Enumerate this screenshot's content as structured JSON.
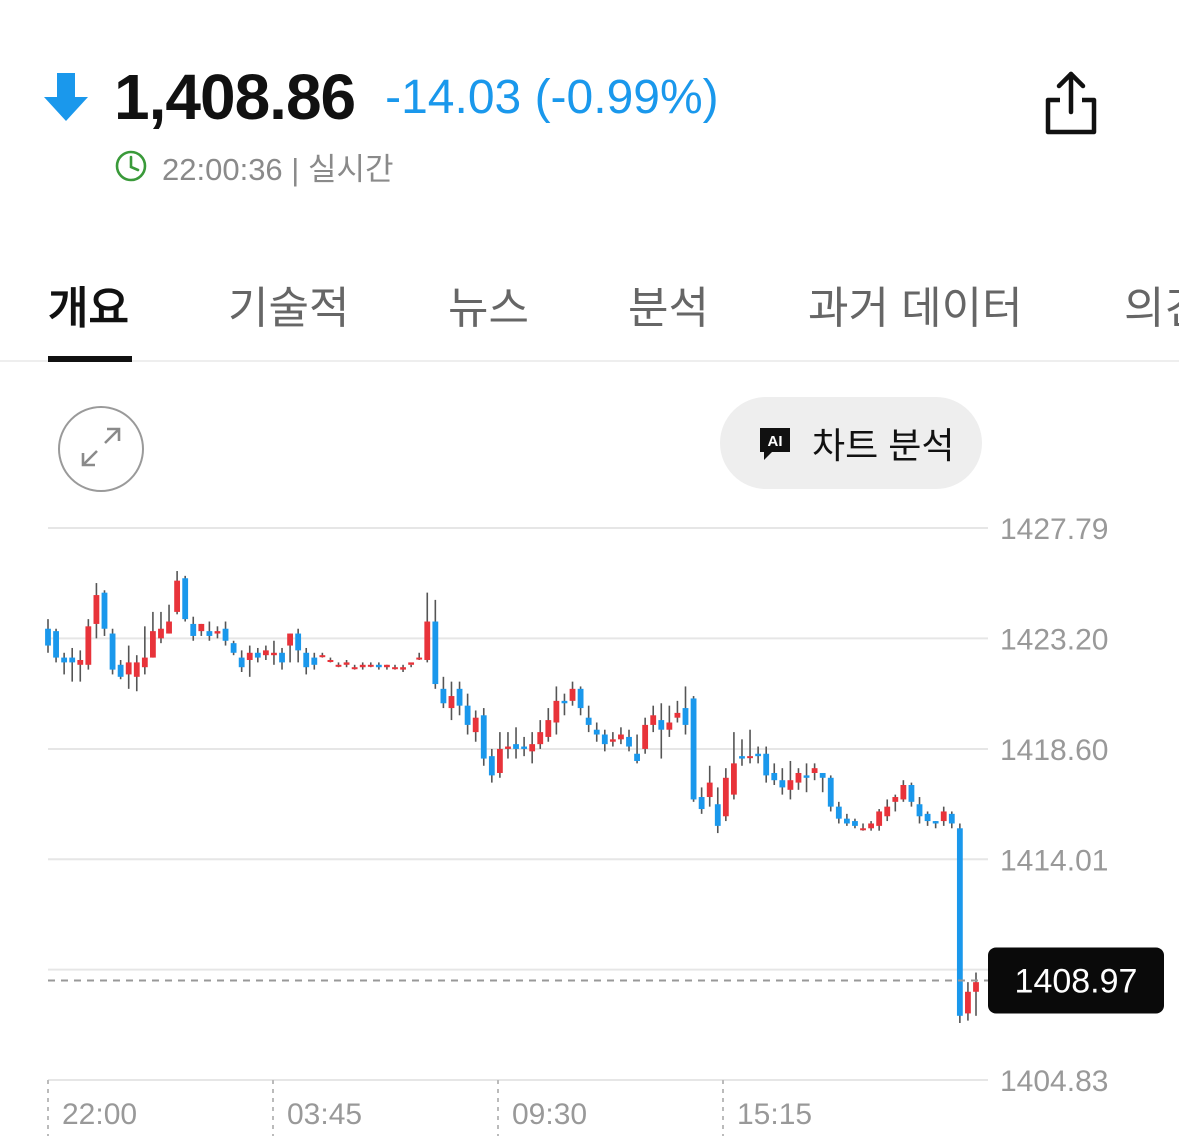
{
  "quote": {
    "direction": "down",
    "price": "1,408.86",
    "change": "-14.03 (-0.99%)",
    "time": "22:00:36 | 실시간",
    "colors": {
      "down": "#1a98ec",
      "up": "#e8333a",
      "clock": "#3a9a3a"
    }
  },
  "tabs": [
    {
      "label": "개요",
      "active": true
    },
    {
      "label": "기술적",
      "active": false
    },
    {
      "label": "뉴스",
      "active": false
    },
    {
      "label": "분석",
      "active": false
    },
    {
      "label": "과거 데이터",
      "active": false
    },
    {
      "label": "의견",
      "active": false
    }
  ],
  "toolbar": {
    "expand_icon": "expand-arrows-icon",
    "ai_badge": "AI",
    "ai_label": "차트 분석"
  },
  "chart_data": {
    "type": "candlestick",
    "y_ticks": [
      "1427.79",
      "1423.20",
      "1418.60",
      "1414.01",
      "1404.83"
    ],
    "ylim": [
      1404.83,
      1427.79
    ],
    "x_ticks": [
      "22:00",
      "03:45",
      "09:30",
      "15:15"
    ],
    "grid": true,
    "current_price_label": "1408.97",
    "current_price": 1408.97,
    "candles": [
      [
        1423.6,
        1422.9,
        1424.0,
        1422.6
      ],
      [
        1423.5,
        1422.4,
        1423.6,
        1422.2
      ],
      [
        1422.4,
        1422.2,
        1422.6,
        1421.7
      ],
      [
        1422.4,
        1422.2,
        1422.8,
        1421.4
      ],
      [
        1422.1,
        1422.3,
        1422.7,
        1421.4
      ],
      [
        1422.1,
        1423.7,
        1424.0,
        1421.9
      ],
      [
        1423.8,
        1425.0,
        1425.5,
        1423.2
      ],
      [
        1425.1,
        1423.6,
        1425.2,
        1423.3
      ],
      [
        1423.4,
        1421.9,
        1423.6,
        1421.7
      ],
      [
        1422.1,
        1421.6,
        1422.3,
        1421.5
      ],
      [
        1421.7,
        1422.2,
        1422.9,
        1421.1
      ],
      [
        1421.6,
        1422.2,
        1422.5,
        1421.0
      ],
      [
        1422.0,
        1422.4,
        1423.7,
        1421.7
      ],
      [
        1422.4,
        1423.5,
        1424.3,
        1422.4
      ],
      [
        1423.2,
        1423.6,
        1424.3,
        1423.0
      ],
      [
        1423.4,
        1423.9,
        1424.6,
        1423.4
      ],
      [
        1424.3,
        1425.6,
        1426.0,
        1424.2
      ],
      [
        1425.7,
        1424.0,
        1425.8,
        1423.9
      ],
      [
        1423.8,
        1423.3,
        1424.1,
        1423.1
      ],
      [
        1423.5,
        1423.8,
        1423.8,
        1423.3
      ],
      [
        1423.5,
        1423.3,
        1423.9,
        1423.1
      ],
      [
        1423.4,
        1423.5,
        1423.7,
        1423.2
      ],
      [
        1423.6,
        1423.1,
        1423.9,
        1422.9
      ],
      [
        1423.0,
        1422.6,
        1423.1,
        1422.5
      ],
      [
        1422.4,
        1422.0,
        1422.7,
        1421.8
      ],
      [
        1422.3,
        1422.6,
        1422.9,
        1421.6
      ],
      [
        1422.6,
        1422.4,
        1422.8,
        1422.2
      ],
      [
        1422.5,
        1422.7,
        1422.9,
        1422.3
      ],
      [
        1422.5,
        1422.6,
        1423.1,
        1422.1
      ],
      [
        1422.6,
        1422.2,
        1422.8,
        1421.9
      ],
      [
        1422.9,
        1423.4,
        1423.4,
        1422.2
      ],
      [
        1423.4,
        1422.7,
        1423.6,
        1422.2
      ],
      [
        1422.6,
        1422.0,
        1422.8,
        1421.7
      ],
      [
        1422.4,
        1422.1,
        1422.6,
        1421.9
      ],
      [
        1422.5,
        1422.5,
        1422.6,
        1422.4
      ],
      [
        1422.3,
        1422.3,
        1422.4,
        1422.2
      ],
      [
        1422.1,
        1422.1,
        1422.2,
        1422.0
      ],
      [
        1422.1,
        1422.2,
        1422.3,
        1422.0
      ],
      [
        1422.0,
        1422.0,
        1422.1,
        1421.9
      ],
      [
        1422.0,
        1422.1,
        1422.2,
        1421.9
      ],
      [
        1422.1,
        1422.1,
        1422.2,
        1422.0
      ],
      [
        1422.1,
        1422.0,
        1422.2,
        1421.9
      ],
      [
        1422.0,
        1422.1,
        1422.1,
        1421.9
      ],
      [
        1422.0,
        1422.0,
        1422.1,
        1421.9
      ],
      [
        1421.9,
        1422.0,
        1422.1,
        1421.8
      ],
      [
        1422.1,
        1422.2,
        1422.1,
        1422.0
      ],
      [
        1422.4,
        1422.4,
        1422.6,
        1422.3
      ],
      [
        1422.3,
        1423.9,
        1425.1,
        1422.2
      ],
      [
        1423.9,
        1421.3,
        1424.8,
        1421.1
      ],
      [
        1421.1,
        1420.5,
        1421.6,
        1420.3
      ],
      [
        1420.3,
        1420.8,
        1421.4,
        1419.8
      ],
      [
        1421.1,
        1420.4,
        1421.4,
        1420.0
      ],
      [
        1420.4,
        1419.6,
        1420.9,
        1419.2
      ],
      [
        1419.3,
        1419.9,
        1420.2,
        1418.9
      ],
      [
        1420.0,
        1418.2,
        1420.3,
        1417.9
      ],
      [
        1418.3,
        1417.5,
        1418.6,
        1417.2
      ],
      [
        1417.6,
        1418.6,
        1419.3,
        1417.4
      ],
      [
        1418.6,
        1418.7,
        1419.3,
        1418.2
      ],
      [
        1418.8,
        1418.6,
        1419.5,
        1418.2
      ],
      [
        1418.7,
        1418.6,
        1419.1,
        1418.3
      ],
      [
        1418.5,
        1418.8,
        1419.3,
        1418.0
      ],
      [
        1418.8,
        1419.3,
        1419.8,
        1418.6
      ],
      [
        1419.1,
        1419.8,
        1420.3,
        1418.9
      ],
      [
        1419.7,
        1420.6,
        1421.2,
        1419.2
      ],
      [
        1420.6,
        1420.5,
        1420.9,
        1420.0
      ],
      [
        1420.6,
        1421.1,
        1421.4,
        1420.4
      ],
      [
        1421.1,
        1420.3,
        1421.2,
        1420.0
      ],
      [
        1419.9,
        1419.6,
        1420.4,
        1419.3
      ],
      [
        1419.4,
        1419.2,
        1419.7,
        1418.9
      ],
      [
        1419.2,
        1418.8,
        1419.4,
        1418.5
      ],
      [
        1418.9,
        1419.0,
        1419.3,
        1418.7
      ],
      [
        1419.0,
        1419.2,
        1419.5,
        1418.8
      ],
      [
        1419.1,
        1418.7,
        1419.4,
        1418.5
      ],
      [
        1418.4,
        1418.1,
        1419.2,
        1418.0
      ],
      [
        1418.6,
        1419.6,
        1419.9,
        1418.4
      ],
      [
        1419.6,
        1420.0,
        1420.4,
        1419.3
      ],
      [
        1419.8,
        1419.4,
        1420.5,
        1418.2
      ],
      [
        1419.4,
        1419.7,
        1420.4,
        1419.1
      ],
      [
        1419.9,
        1420.1,
        1420.6,
        1419.7
      ],
      [
        1420.3,
        1419.6,
        1421.2,
        1419.2
      ],
      [
        1420.7,
        1416.5,
        1420.8,
        1416.4
      ],
      [
        1416.6,
        1416.1,
        1417.0,
        1415.9
      ],
      [
        1416.6,
        1417.2,
        1417.9,
        1416.2
      ],
      [
        1416.3,
        1415.4,
        1417.0,
        1415.1
      ],
      [
        1415.8,
        1417.4,
        1417.8,
        1415.6
      ],
      [
        1416.7,
        1418.0,
        1419.3,
        1416.5
      ],
      [
        1418.3,
        1418.2,
        1419.0,
        1417.9
      ],
      [
        1418.3,
        1418.3,
        1419.4,
        1418.0
      ],
      [
        1418.4,
        1418.3,
        1418.7,
        1418.0
      ],
      [
        1418.4,
        1417.5,
        1418.7,
        1417.2
      ],
      [
        1417.6,
        1417.3,
        1418.0,
        1417.1
      ],
      [
        1417.3,
        1417.0,
        1417.8,
        1416.7
      ],
      [
        1416.9,
        1417.3,
        1418.1,
        1416.5
      ],
      [
        1417.2,
        1417.6,
        1417.8,
        1416.9
      ],
      [
        1417.5,
        1417.4,
        1418.0,
        1416.8
      ],
      [
        1417.6,
        1417.8,
        1418.0,
        1417.3
      ],
      [
        1417.6,
        1417.4,
        1417.6,
        1416.8
      ],
      [
        1417.4,
        1416.2,
        1417.5,
        1416.0
      ],
      [
        1416.2,
        1415.7,
        1416.4,
        1415.5
      ],
      [
        1415.7,
        1415.5,
        1415.9,
        1415.4
      ],
      [
        1415.6,
        1415.4,
        1415.7,
        1415.3
      ],
      [
        1415.3,
        1415.3,
        1415.5,
        1415.2
      ],
      [
        1415.3,
        1415.5,
        1415.6,
        1415.2
      ],
      [
        1415.4,
        1416.0,
        1416.1,
        1415.2
      ],
      [
        1415.8,
        1416.2,
        1416.5,
        1415.6
      ],
      [
        1416.4,
        1416.6,
        1416.7,
        1416.0
      ],
      [
        1416.5,
        1417.1,
        1417.3,
        1416.4
      ],
      [
        1417.1,
        1416.4,
        1417.2,
        1416.2
      ],
      [
        1416.3,
        1415.8,
        1416.6,
        1415.5
      ],
      [
        1415.9,
        1415.6,
        1416.0,
        1415.4
      ],
      [
        1415.6,
        1415.5,
        1415.6,
        1415.3
      ],
      [
        1415.6,
        1416.0,
        1416.2,
        1415.4
      ],
      [
        1415.9,
        1415.5,
        1416.0,
        1415.3
      ],
      [
        1415.3,
        1407.5,
        1415.5,
        1407.2
      ],
      [
        1407.6,
        1408.5,
        1408.9,
        1407.3
      ],
      [
        1408.5,
        1408.9,
        1409.3,
        1407.5
      ]
    ]
  }
}
